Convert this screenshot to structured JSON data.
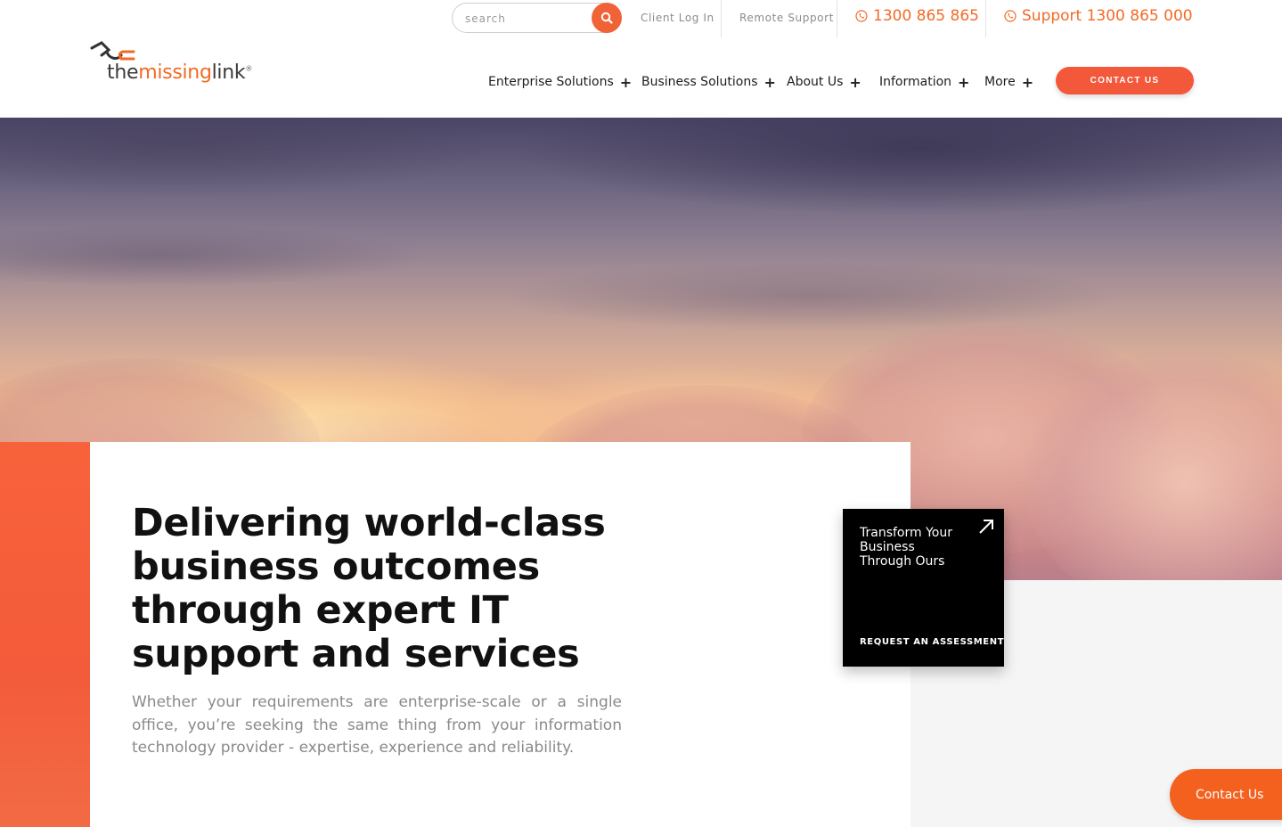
{
  "brand": {
    "logo_the": "the",
    "logo_missing": "missing",
    "logo_link": "link",
    "logo_reg": "®",
    "accent_color": "#f26a25"
  },
  "search": {
    "placeholder": "search",
    "icon": "search-icon"
  },
  "utility_nav": {
    "client_login": "Client Log In",
    "remote_support": "Remote Support",
    "phone_sales": "1300 865 865",
    "phone_support": "Support 1300 865 000",
    "phone_icon": "phone-icon"
  },
  "main_nav": {
    "items": [
      {
        "label": "Enterprise Solutions",
        "expand": "+"
      },
      {
        "label": "Business Solutions",
        "expand": "+"
      },
      {
        "label": "About Us",
        "expand": "+"
      },
      {
        "label": "Information",
        "expand": "+"
      },
      {
        "label": "More",
        "expand": "+"
      }
    ],
    "contact_label": "CONTACT US"
  },
  "hero": {
    "headline": "Delivering world-class business outcomes through expert IT support and services",
    "subtext": "Whether your requirements are enterprise-scale or a single office, you’re seeking the same thing from your information technology provider - expertise, experience and reliability."
  },
  "assessment_card": {
    "title": "Transform Your Business Through Ours",
    "cta": "REQUEST AN ASSESSMENT",
    "icon": "arrow-up-right-icon"
  },
  "floating_contact": {
    "label": "Contact Us"
  }
}
